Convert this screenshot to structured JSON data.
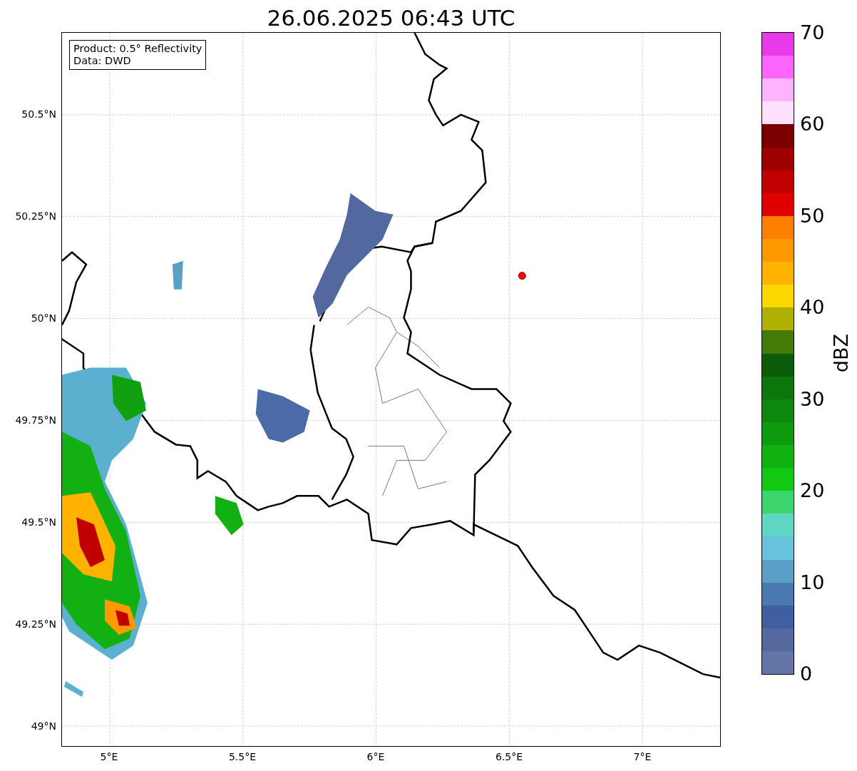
{
  "title": "26.06.2025 06:43 UTC",
  "legend": {
    "lines": [
      "Product: 0.5° Reflectivity",
      "Data: DWD"
    ]
  },
  "axes": {
    "yticks": [
      "50.5°N",
      "50.25°N",
      "50°N",
      "49.75°N",
      "49.5°N",
      "49.25°N",
      "49°N"
    ],
    "xticks": [
      "5°E",
      "5.5°E",
      "6°E",
      "6.5°E",
      "7°E"
    ]
  },
  "colorbar": {
    "label": "dBZ",
    "ticks": [
      "70",
      "60",
      "50",
      "40",
      "30",
      "20",
      "10",
      "0"
    ],
    "segments": [
      {
        "color": "#e93ae9"
      },
      {
        "color": "#ff66ff"
      },
      {
        "color": "#ffb3ff"
      },
      {
        "color": "#ffe0ff"
      },
      {
        "color": "#7a0000"
      },
      {
        "color": "#9e0000"
      },
      {
        "color": "#c00000"
      },
      {
        "color": "#e00000"
      },
      {
        "color": "#ff7f00"
      },
      {
        "color": "#ff9900"
      },
      {
        "color": "#ffb300"
      },
      {
        "color": "#ffd700"
      },
      {
        "color": "#b0b000"
      },
      {
        "color": "#457a07"
      },
      {
        "color": "#0a5c0a"
      },
      {
        "color": "#0b760b"
      },
      {
        "color": "#0d870d"
      },
      {
        "color": "#0e9b0e"
      },
      {
        "color": "#10b010"
      },
      {
        "color": "#13c813"
      },
      {
        "color": "#3dd66e"
      },
      {
        "color": "#5fd6c3"
      },
      {
        "color": "#66c2dd"
      },
      {
        "color": "#5b9fc6"
      },
      {
        "color": "#4a7ab0"
      },
      {
        "color": "#3f5fa0"
      },
      {
        "color": "#52689f"
      },
      {
        "color": "#6476a8"
      }
    ]
  }
}
